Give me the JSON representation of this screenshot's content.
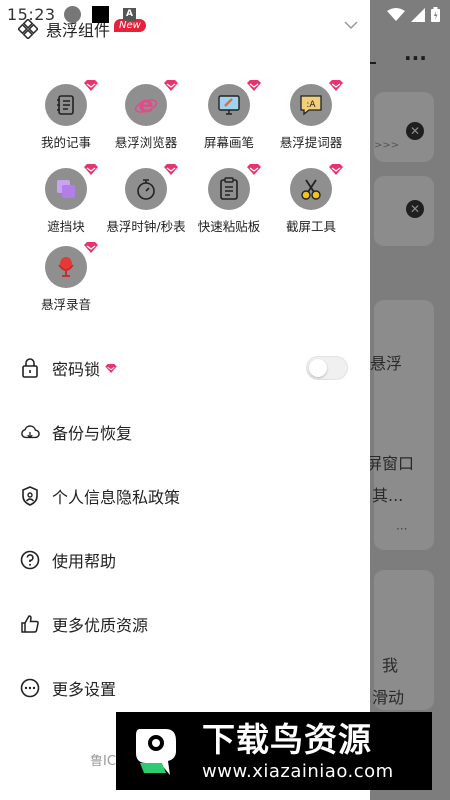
{
  "status_bar": {
    "time": "15:23",
    "indicator": "A"
  },
  "drawer": {
    "header": {
      "title": "悬浮组件",
      "badge": "New"
    },
    "widgets": [
      {
        "label": "我的记事",
        "icon": "notebook-icon",
        "vip": true
      },
      {
        "label": "悬浮浏览器",
        "icon": "browser-icon",
        "vip": true
      },
      {
        "label": "屏幕画笔",
        "icon": "screen-pen-icon",
        "vip": true
      },
      {
        "label": "悬浮提词器",
        "icon": "teleprompter-icon",
        "vip": true
      },
      {
        "label": "遮挡块",
        "icon": "block-icon",
        "vip": true
      },
      {
        "label": "悬浮时钟/秒表",
        "icon": "stopwatch-icon",
        "vip": true
      },
      {
        "label": "快速粘贴板",
        "icon": "clipboard-icon",
        "vip": true
      },
      {
        "label": "截屏工具",
        "icon": "scissors-icon",
        "vip": true
      },
      {
        "label": "悬浮录音",
        "icon": "microphone-icon",
        "vip": true
      }
    ],
    "menu": [
      {
        "label": "密码锁",
        "icon": "lock-icon",
        "vip": true,
        "toggle": false
      },
      {
        "label": "备份与恢复",
        "icon": "cloud-icon"
      },
      {
        "label": "个人信息隐私政策",
        "icon": "shield-icon"
      },
      {
        "label": "使用帮助",
        "icon": "help-icon"
      },
      {
        "label": "更多优质资源",
        "icon": "thumbs-up-icon"
      },
      {
        "label": "更多设置",
        "icon": "more-icon"
      }
    ],
    "footer": "鲁IC"
  },
  "background": {
    "more": "···",
    "texts": [
      "悬浮",
      "屏窗口",
      "其...",
      "···",
      "我",
      "滑动"
    ],
    "arrows": ">>>"
  },
  "watermark": {
    "title": "下载鸟资源",
    "url": "www.xiazainiao.com"
  },
  "colors": {
    "accent": "#e8336d",
    "icon_bg": "#8f8f8f",
    "badge": "#e5223a",
    "scrim": "#7d7d7d"
  }
}
